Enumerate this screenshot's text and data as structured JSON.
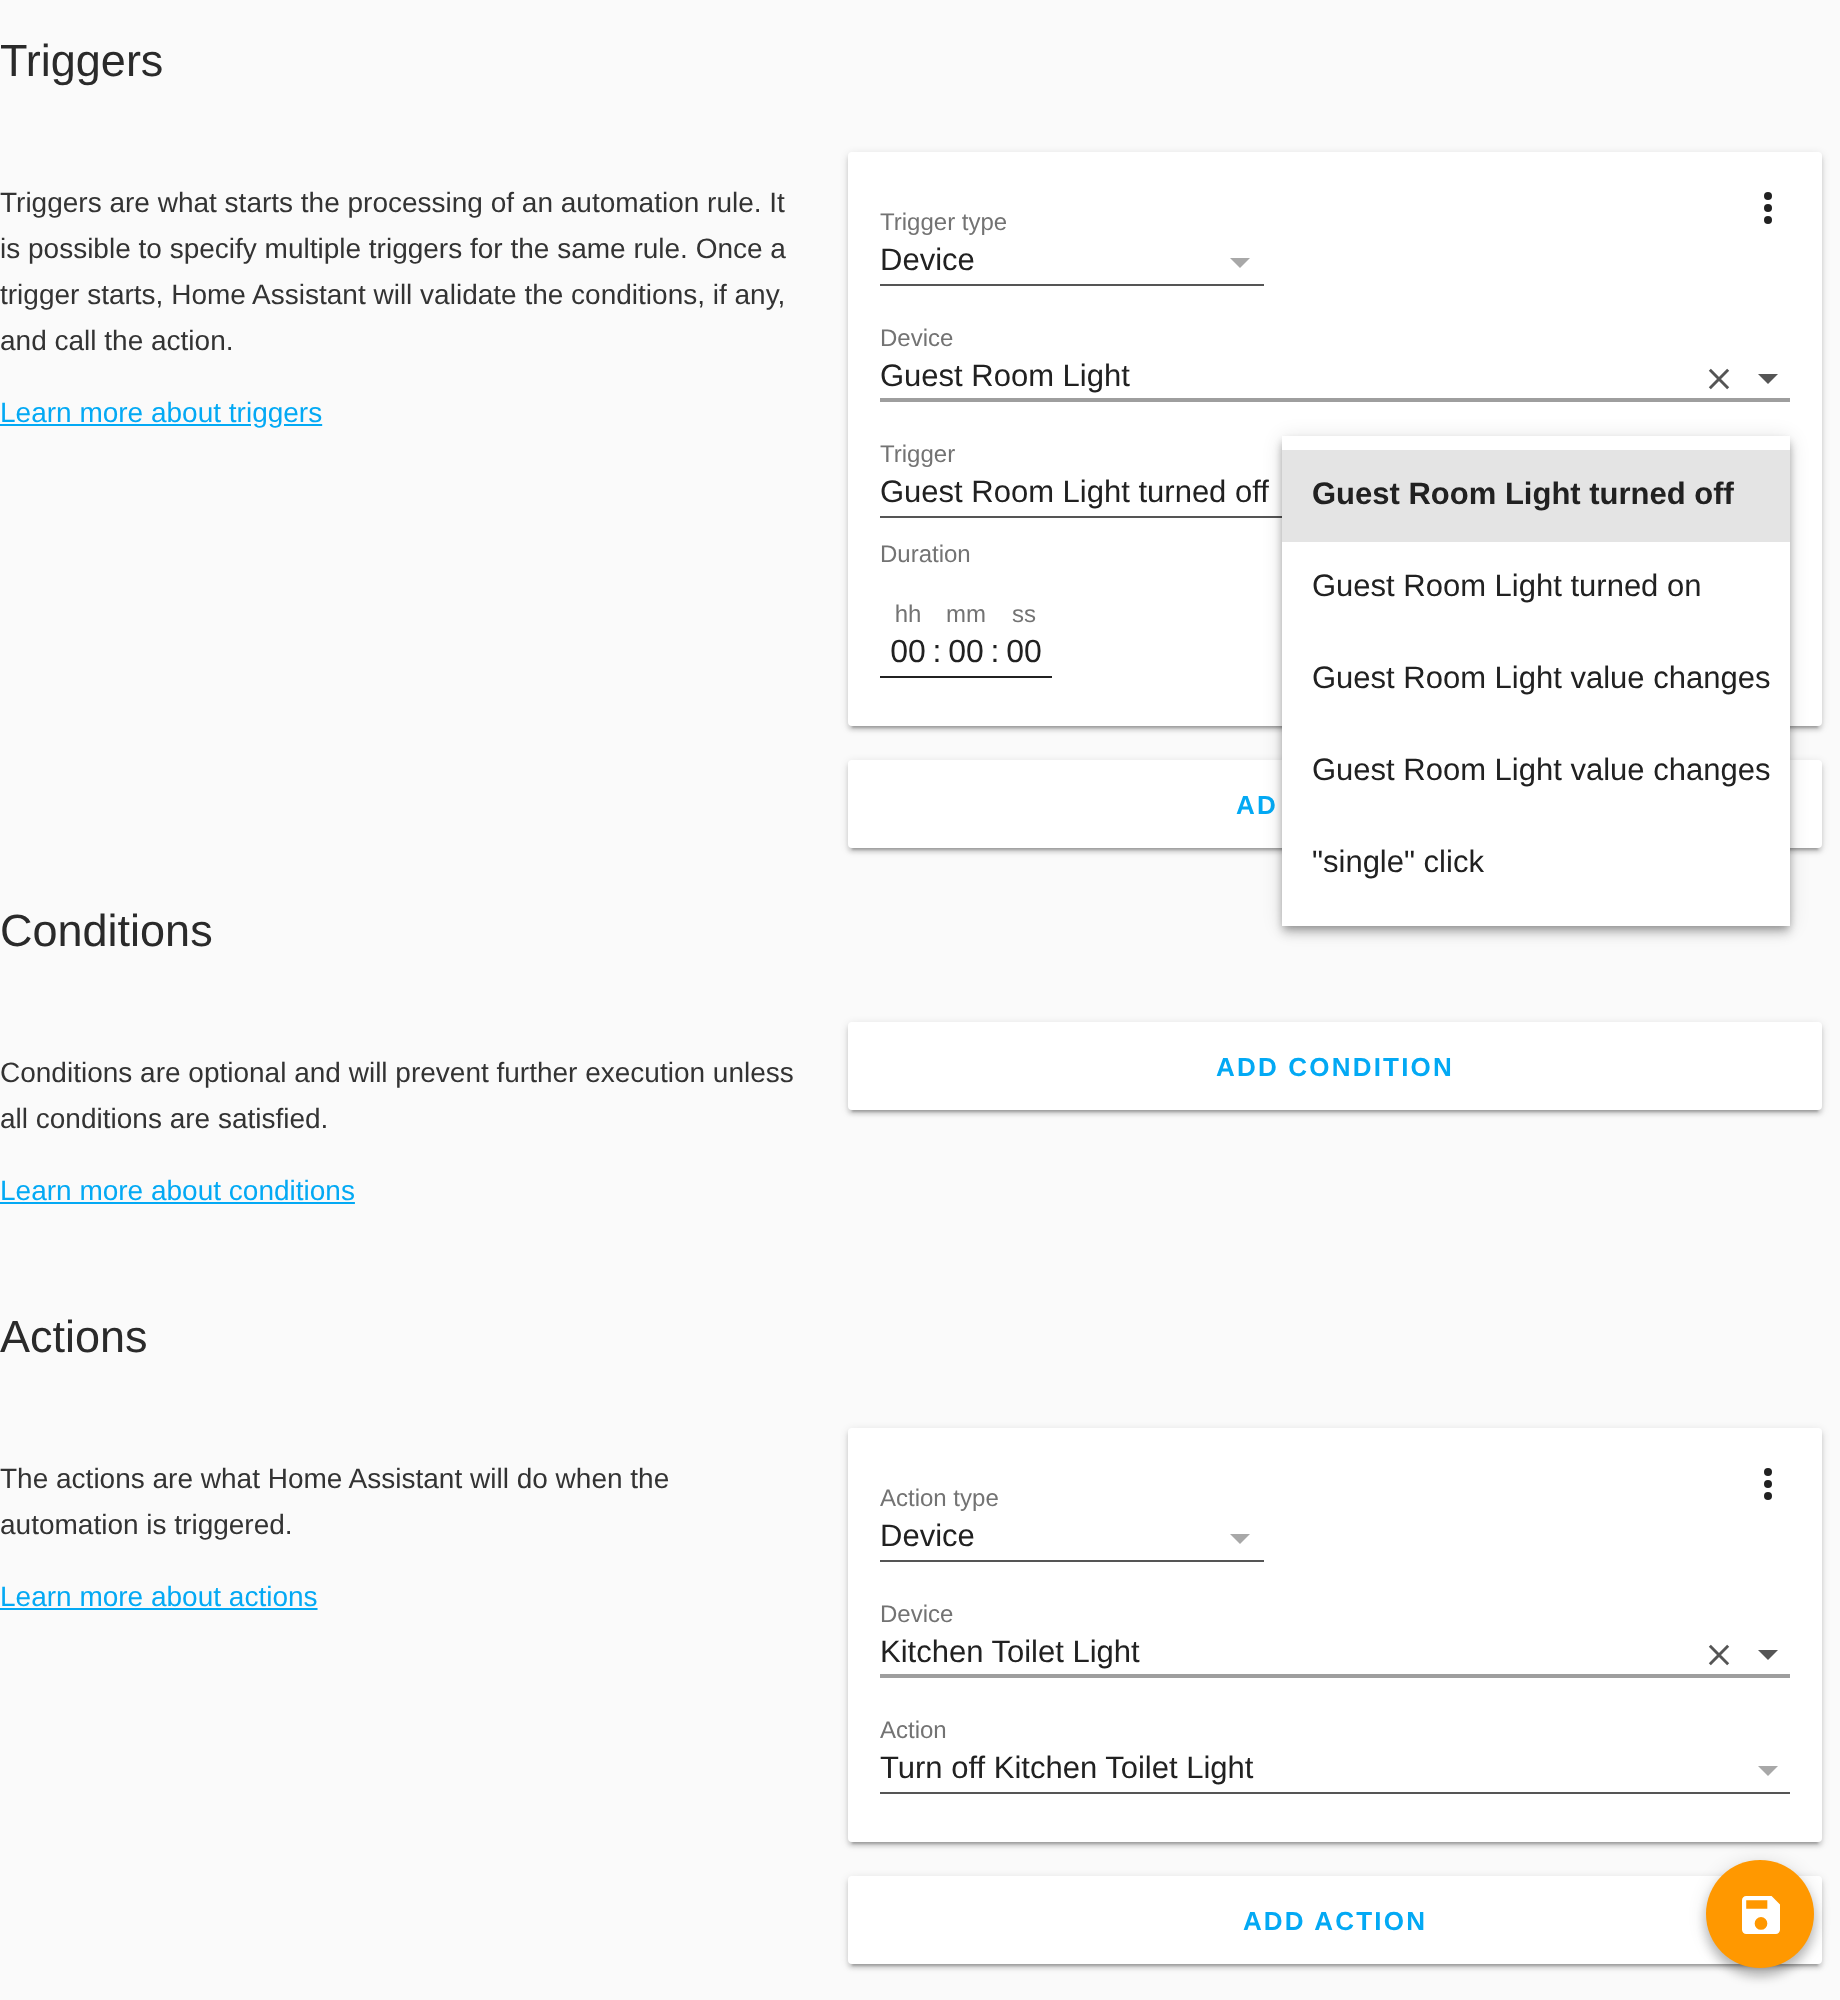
{
  "sections": [
    {
      "title": "Triggers",
      "description": "Triggers are what starts the processing of an automation rule. It is possible to specify multiple triggers for the same rule. Once a trigger starts, Home Assistant will validate the conditions, if any, and call the action.",
      "link": "Learn more about triggers",
      "cards": [
        {
          "kind": "editor",
          "fields": [
            {
              "kind": "type",
              "label": "Trigger type",
              "value": "Device"
            },
            {
              "kind": "combo",
              "label": "Device",
              "value": "Guest Room Light"
            },
            {
              "kind": "select",
              "label": "Trigger",
              "value": "Guest Room Light turned off",
              "options": [
                {
                  "label": "Guest Room Light turned off",
                  "selected": true
                },
                {
                  "label": "Guest Room Light turned on",
                  "selected": false
                },
                {
                  "label": "Guest Room Light value changes",
                  "selected": false
                },
                {
                  "label": "Guest Room Light value changes",
                  "selected": false
                },
                {
                  "label": "\"single\" click",
                  "selected": false
                }
              ]
            },
            {
              "kind": "duration",
              "label": "Duration",
              "units": [
                "hh",
                "mm",
                "ss"
              ],
              "values": [
                "00",
                "00",
                "00"
              ],
              "separators": [
                ":",
                ":"
              ]
            }
          ]
        },
        {
          "kind": "add",
          "label": "AD"
        }
      ]
    },
    {
      "title": "Conditions",
      "description": "Conditions are optional and will prevent further execution unless all conditions are satisfied.",
      "link": "Learn more about conditions",
      "cards": [
        {
          "kind": "add",
          "label": "ADD CONDITION"
        }
      ]
    },
    {
      "title": "Actions",
      "description": "The actions are what Home Assistant will do when the automation is triggered.",
      "link": "Learn more about actions",
      "cards": [
        {
          "kind": "editor",
          "fields": [
            {
              "kind": "type",
              "label": "Action type",
              "value": "Device"
            },
            {
              "kind": "combo",
              "label": "Device",
              "value": "Kitchen Toilet Light"
            },
            {
              "kind": "select",
              "label": "Action",
              "value": "Turn off Kitchen Toilet Light"
            }
          ]
        },
        {
          "kind": "add",
          "label": "ADD ACTION"
        }
      ]
    }
  ]
}
